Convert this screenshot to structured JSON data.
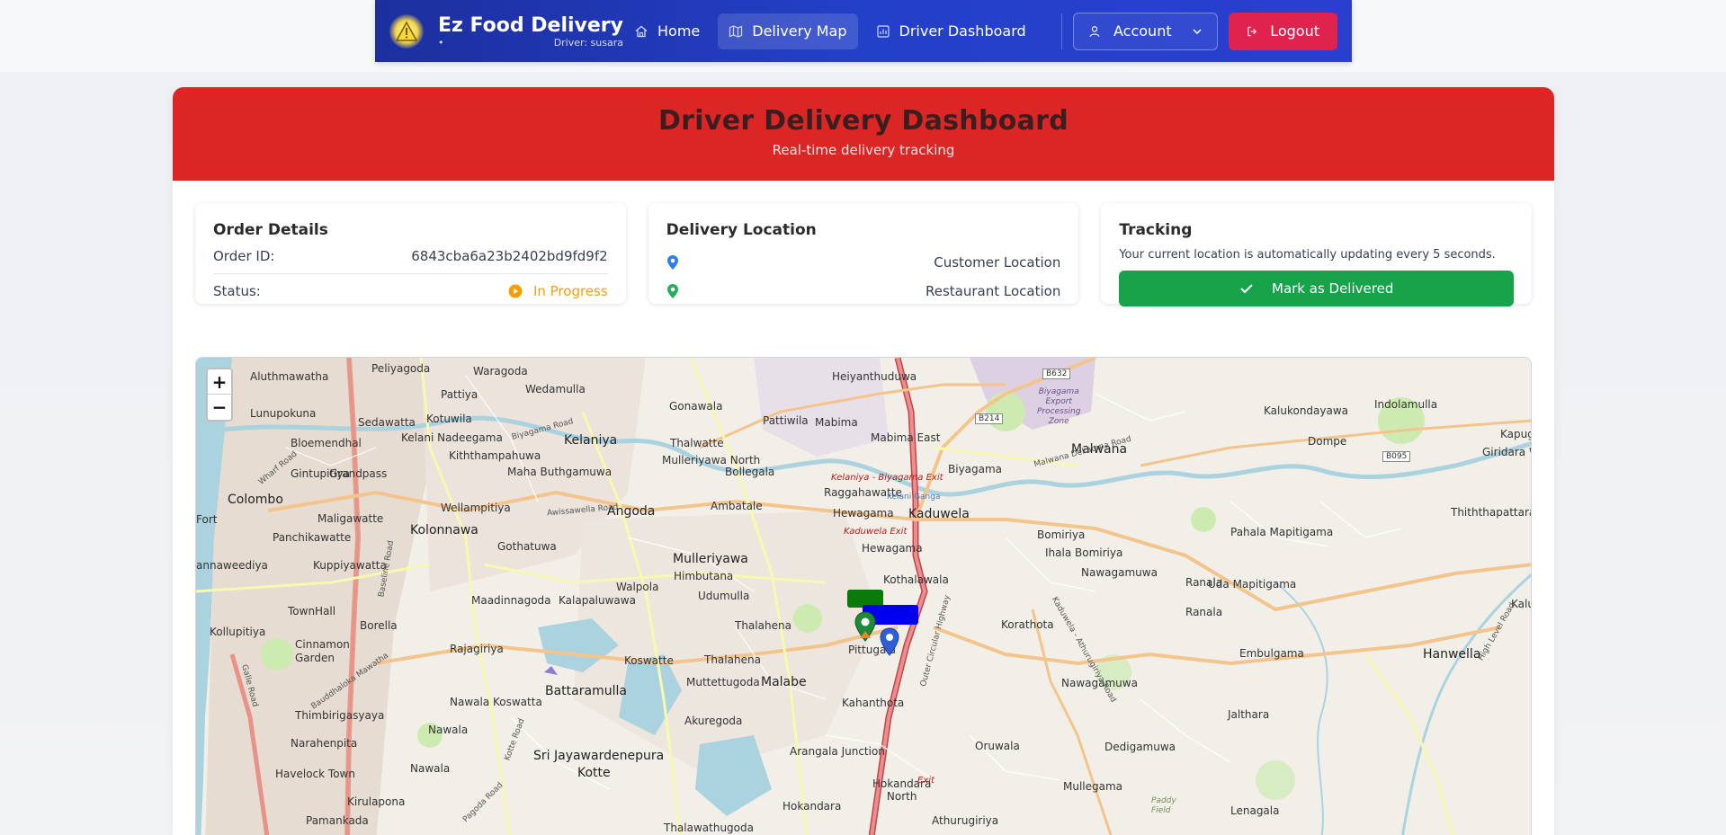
{
  "navbar": {
    "brand_title": "Ez Food Delivery",
    "brand_dot": "•",
    "driver_label": "Driver: susara",
    "items": [
      {
        "label": "Home",
        "icon": "home-icon",
        "active": false
      },
      {
        "label": "Delivery Map",
        "icon": "map-icon",
        "active": true
      },
      {
        "label": "Driver Dashboard",
        "icon": "dashboard-icon",
        "active": false
      }
    ],
    "account_label": "Account",
    "logout_label": "Logout"
  },
  "hero": {
    "title": "Driver Delivery Dashboard",
    "subtitle": "Real-time delivery tracking"
  },
  "order_details": {
    "title": "Order Details",
    "order_id_label": "Order ID:",
    "order_id_value": "6843cba6a23b2402bd9fd9f2",
    "status_label": "Status:",
    "status_value": "In Progress"
  },
  "delivery_location": {
    "title": "Delivery Location",
    "customer_label": "Customer Location",
    "restaurant_label": "Restaurant Location"
  },
  "tracking": {
    "title": "Tracking",
    "text": "Your current location is automatically updating every 5 seconds.",
    "button_label": "Mark as Delivered"
  },
  "map": {
    "zoom_in": "+",
    "zoom_out": "−",
    "places": {
      "aluthmawatha": "Aluthmawatha",
      "peliyagoda": "Peliyagoda",
      "waragoda": "Waragoda",
      "pattiya": "Pattiya",
      "wedamulla": "Wedamulla",
      "heiyanthuduwa": "Heiyanthuduwa",
      "lunupokuna": "Lunupokuna",
      "sedawatta": "Sedawatta",
      "kotuwila": "Kotuwila",
      "gonawala": "Gonawala",
      "pattiwila": "Pattiwila",
      "mabima": "Mabima",
      "kalukondayawa": "Kalukondayawa",
      "indolamulla": "Indolamulla",
      "bloemendhal": "Bloemendhal",
      "kelani_nadeegama": "Kelani Nadeegama",
      "kelaniya": "Kelaniya",
      "thalwatte": "Thalwatte",
      "mabima_east": "Mabima East",
      "malwana": "Malwana",
      "dompe": "Dompe",
      "kiththampahuwa": "Kiththampahuwa",
      "mulleriyawa_north": "Mulleriyawa North",
      "gintupitiya": "Gintupitiya",
      "grandpass": "Grandpass",
      "maha_buthgamuwa": "Maha Buthgamuwa",
      "bollegala": "Bollegala",
      "biyagama": "Biyagama",
      "giridara": "Giridara W",
      "kapuge": "Kapug",
      "colombo": "Colombo",
      "wellampitiya": "Wellampitiya",
      "angoda": "Angoda",
      "ambatale": "Ambatale",
      "raggahawatte": "Raggahawatte",
      "hewagama": "Hewagama",
      "kaduwela": "Kaduwela",
      "thiththapattara": "Thiththapattara",
      "fort": "Fort",
      "maligawatte": "Maligawatte",
      "panchikawatte": "Panchikawatte",
      "kolonnawa": "Kolonnawa",
      "gothatuwa": "Gothatuwa",
      "bomiriya": "Bomiriya",
      "pahala_mapitigama": "Pahala Mapitigama",
      "ihala_bomiriya": "Ihala Bomiriya",
      "hewagama2": "Hewagama",
      "mulleriyawa": "Mulleriyawa",
      "himbutana": "Himbutana",
      "kothalawala": "Kothalawala",
      "kuppiyawatta": "Kuppiyawatta",
      "annaweediya": "annaweediya",
      "nawagamuwa": "Nawagamuwa",
      "uda_mapitigama": "Uda Mapitigama",
      "walpola": "Walpola",
      "udumulla": "Udumulla",
      "maadinnagoda": "Maadinnagoda",
      "kalapaluwawa": "Kalapaluwawa",
      "ranala": "Ranala",
      "kalu": "Kalu",
      "townhall": "TownHall",
      "borella": "Borella",
      "thalahena": "Thalahena",
      "korathota": "Korathota",
      "kollupitiya": "Kollupitiya",
      "rajagiriya": "Rajagiriya",
      "koswatte": "Koswatte",
      "thalahena2": "Thalahena",
      "pittugala": "Pittugala",
      "embulgama": "Embulgama",
      "hanwella": "Hanwella",
      "cinnamon_garden": "Cinnamon\nGarden",
      "nawagamuwa2": "Nawagamuwa",
      "battaramulla": "Battaramulla",
      "mutteltugoda": "Muttettugoda",
      "malabe": "Malabe",
      "kahanthota": "Kahanthota",
      "nawala_koswatta": "Nawala Koswatta",
      "thimbirigasyaya": "Thimbirigasyaya",
      "jalthara": "Jalthara",
      "nawala": "Nawala",
      "akuregoda": "Akuregoda",
      "oruwala": "Oruwala",
      "narahenpita": "Narahenpita",
      "dedigamuwa": "Dedigamuwa",
      "sri_jaya": "Sri Jayawardenepura",
      "kotte": "Kotte",
      "arangala_junction": "Arangala Junction",
      "havelock_town": "Havelock Town",
      "nawala2": "Nawala",
      "hokandara_north": "Hokandara\nNorth",
      "mullegama": "Mullegama",
      "kirulapona": "Kirulapona",
      "hokandara": "Hokandara",
      "lenagala": "Lenagala",
      "pamankada": "Pamankada",
      "athurugiriya": "Athurugiriya",
      "thalawathugoda": "Thalawathugoda",
      "biyagama_export": "Biyagama\nExport\nProcessing\nZone",
      "paddy_field": "Paddy\nField"
    },
    "exits": {
      "kelaniya_exit": "Kelaniya - Biyagama Exit",
      "kaduwela_exit": "Kaduwela Exit",
      "exit": "Exit"
    },
    "roads": {
      "biyagama_road": "Biyagama Road",
      "awissawella_road": "Awissawella Road",
      "baseline_road": "Baseline Road",
      "outer_circular": "Outer Circular Highway",
      "wharf_road": "Wharf Road",
      "malwana_road": "Malwana Dekatana Road",
      "kaduwela_road": "Kaduwela - Athurugiriya Road",
      "high_level_road": "High Level Road",
      "galle_road": "Galle Road",
      "kotte_road": "Kotte Road",
      "bauddhaloka": "Bauddhaloka Mawatha",
      "pagoda_road": "Pagoda Road",
      "ganga": "Kelani Ganga"
    },
    "shields": {
      "b632": "B632",
      "b214": "B214",
      "b095": "B095"
    },
    "customer_color": "#2f5fd6",
    "restaurant_color": "#2aa84a"
  },
  "colors": {
    "nav_bg": "#2340c9",
    "hero_bg": "#dc2626",
    "logout_bg": "#e0234e",
    "delivered_bg": "#16a34a",
    "status_color": "#f59e0b"
  }
}
